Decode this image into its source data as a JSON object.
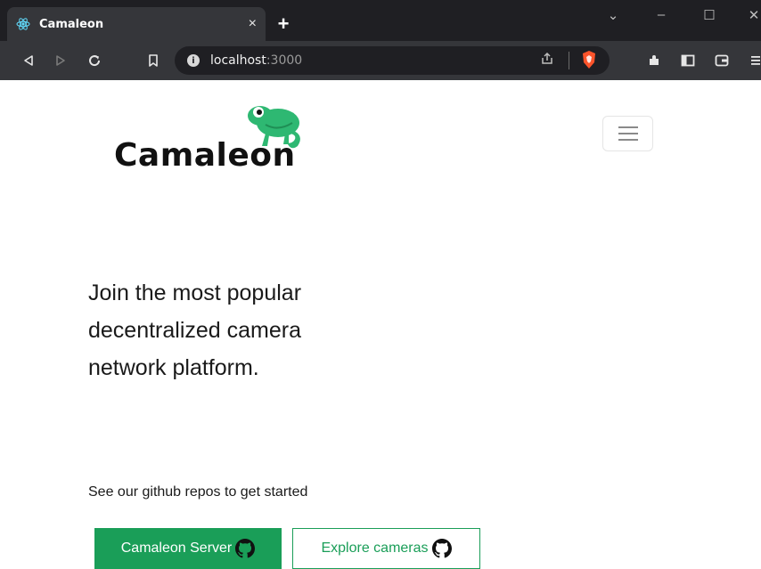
{
  "browser": {
    "tab_title": "Camaleon",
    "tab_close": "×",
    "new_tab": "+",
    "url_host": "localhost",
    "url_port": ":3000",
    "window_controls": [
      "⌄",
      "–",
      "☐",
      "✕"
    ],
    "nav_icons": [
      "back-icon",
      "forward-icon",
      "reload-icon",
      "bookmark-icon"
    ],
    "toolbar_icons": [
      "share-icon",
      "brave-shield-icon",
      "extensions-icon",
      "sidebar-icon",
      "wallet-icon",
      "menu-icon"
    ]
  },
  "page": {
    "logo_text": "Camaleon",
    "headline": "Join the most popular decentralized camera network platform.",
    "subtext": "See our github repos to get started",
    "buttons": {
      "server": "Camaleon Server",
      "explore": "Explore cameras"
    }
  },
  "colors": {
    "brand_green": "#1a9e58",
    "chrome_dark": "#1f1f23",
    "chrome_mid": "#35363a"
  }
}
